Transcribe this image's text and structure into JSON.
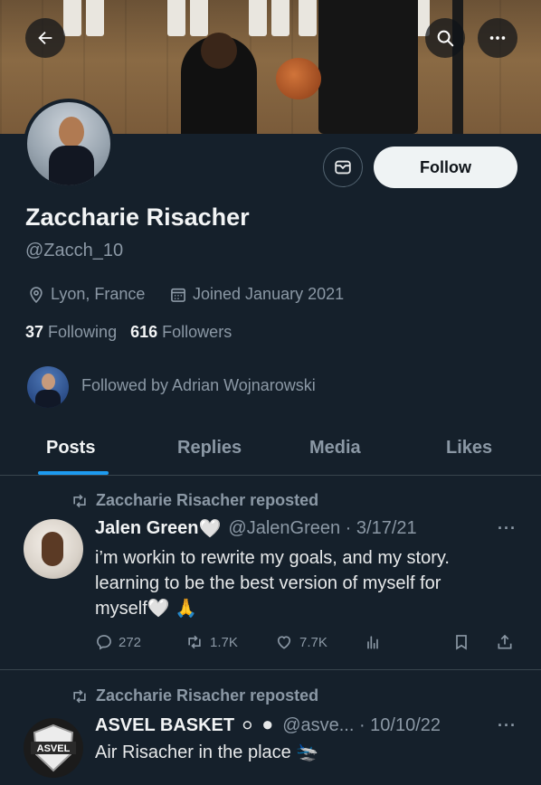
{
  "header": {
    "back_icon": "arrow-left-icon",
    "search_icon": "search-icon",
    "more_icon": "more-horizontal-icon"
  },
  "profile": {
    "name": "Zaccharie Risacher",
    "handle": "@Zacch_10",
    "location": "Lyon, France",
    "joined": "Joined January 2021",
    "following_count": "37",
    "following_label": "Following",
    "followers_count": "616",
    "followers_label": "Followers",
    "followed_by": "Followed by Adrian Wojnarowski",
    "follow_label": "Follow",
    "message_icon": "message-icon"
  },
  "tabs": [
    {
      "label": "Posts",
      "active": true
    },
    {
      "label": "Replies",
      "active": false
    },
    {
      "label": "Media",
      "active": false
    },
    {
      "label": "Likes",
      "active": false
    }
  ],
  "posts": [
    {
      "repost_text": "Zaccharie Risacher reposted",
      "author": "Jalen Green",
      "author_emoji": "🤍",
      "handle_date": "@JalenGreen · 3/17/21",
      "text_lines": [
        "i’m workin to rewrite my goals, and my story.",
        "learning to be the best version of myself for",
        "myself🤍 🙏"
      ],
      "replies": "272",
      "reposts": "1.7K",
      "likes": "7.7K"
    },
    {
      "repost_text": "Zaccharie Risacher reposted",
      "author": "ASVEL BASKET",
      "author_emoji": "⚪ ⚫",
      "handle_date": "@asve... · 10/10/22",
      "text": "Air Risacher in the place 🛬",
      "avatar_text": "ASVEL"
    }
  ],
  "colors": {
    "background": "#15202b",
    "accent": "#1d9bf0",
    "muted": "#8b98a5"
  }
}
